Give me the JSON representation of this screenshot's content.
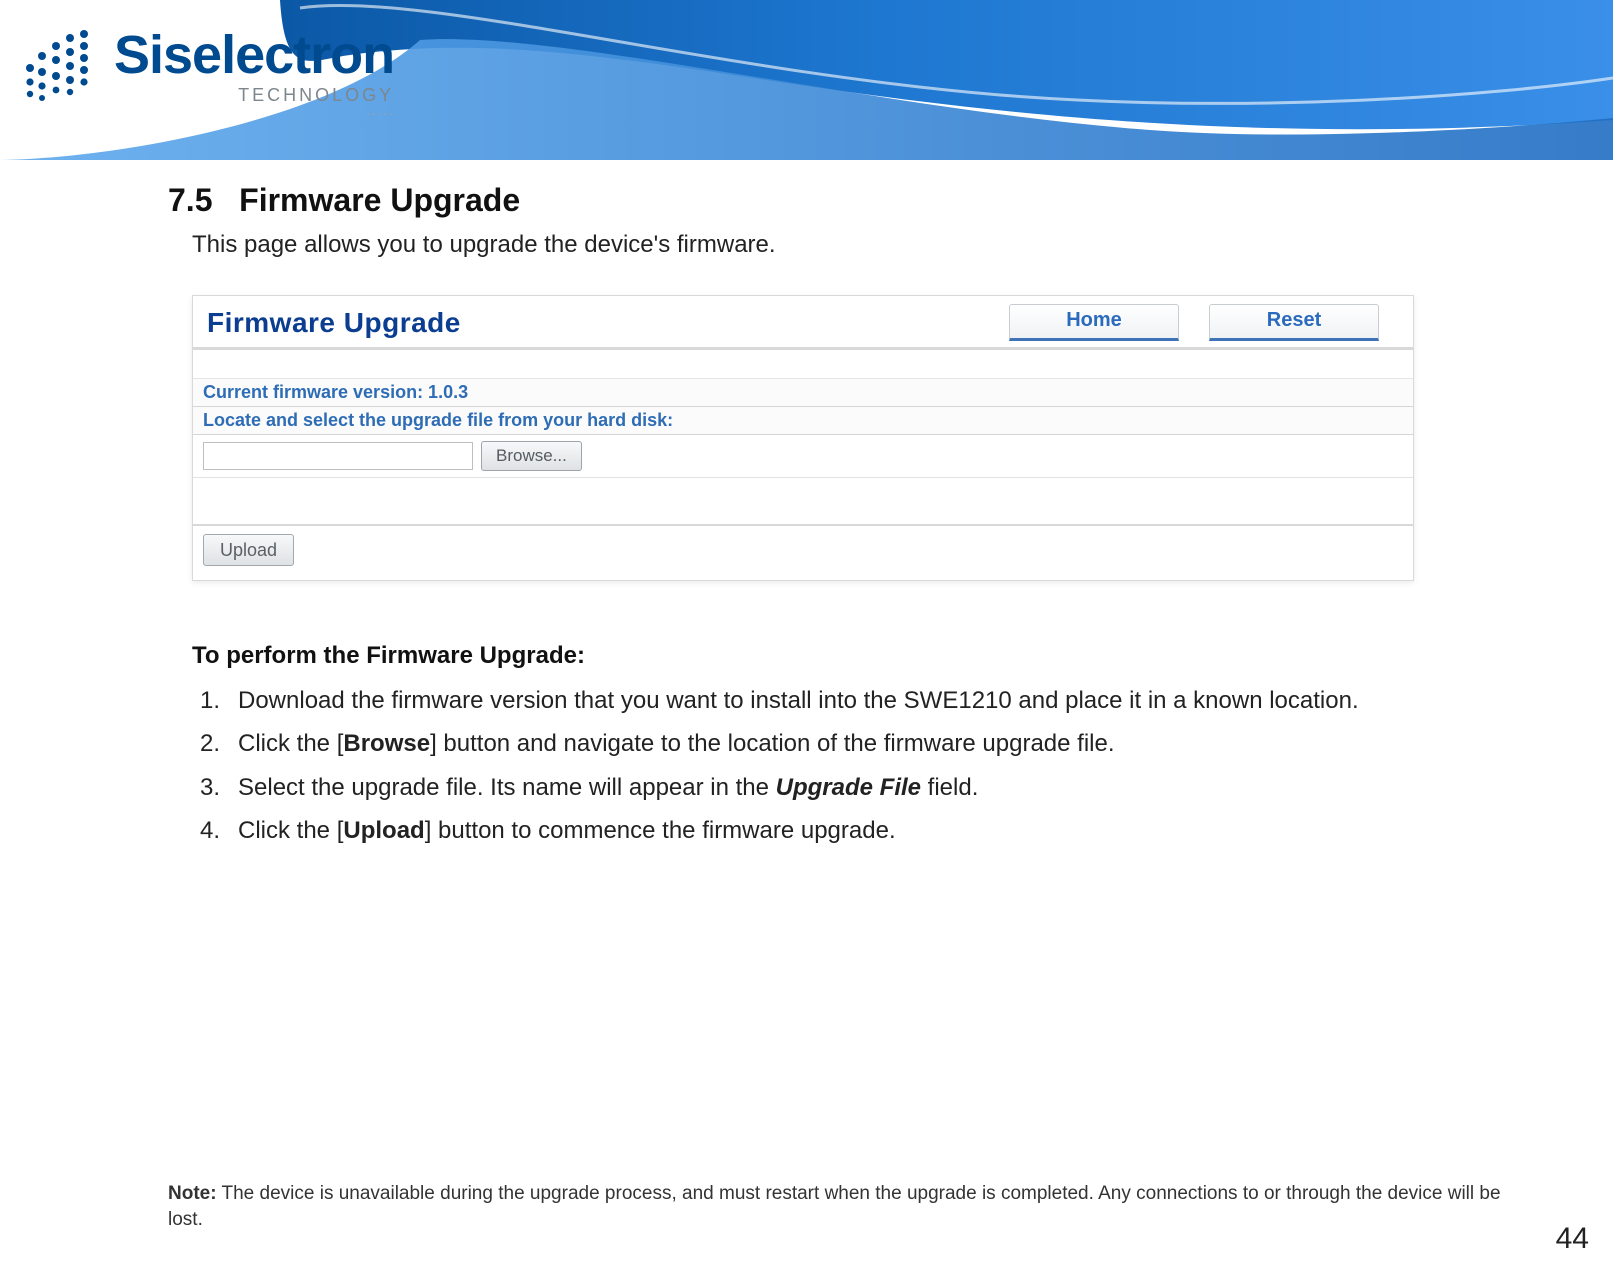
{
  "logo": {
    "wordmark": "Siselectron",
    "subline": "TECHNOLOGY",
    "tagline": "·····"
  },
  "section": {
    "number": "7.5",
    "title": "Firmware Upgrade",
    "intro": "This page allows you to upgrade the device's firmware."
  },
  "ui": {
    "panel_title": "Firmware Upgrade",
    "home_btn": "Home",
    "reset_btn": "Reset",
    "current_fw_label": "Current firmware version: 1.0.3",
    "locate_label": "Locate and select the upgrade file from your hard disk:",
    "browse_btn": "Browse...",
    "upload_btn": "Upload",
    "file_value": ""
  },
  "instructions": {
    "heading": "To perform the Firmware Upgrade:",
    "step1": "Download the firmware version that you want to install into the SWE1210 and place it in a known location.",
    "step2_prefix": "Click the [",
    "step2_bold": "Browse",
    "step2_suffix": "] button and navigate to the location of the firmware upgrade file.",
    "step3_prefix": "Select the upgrade file. Its name will appear in the ",
    "step3_bolditalic": "Upgrade File",
    "step3_suffix": " field.",
    "step4_prefix": "Click the [",
    "step4_bold": "Upload",
    "step4_suffix": "] button to commence the firmware upgrade."
  },
  "footnote": {
    "bold": "Note:",
    "text": " The device is unavailable during the upgrade process, and must restart when the upgrade is completed. Any connections to or through the device will be lost."
  },
  "page_number": "44"
}
